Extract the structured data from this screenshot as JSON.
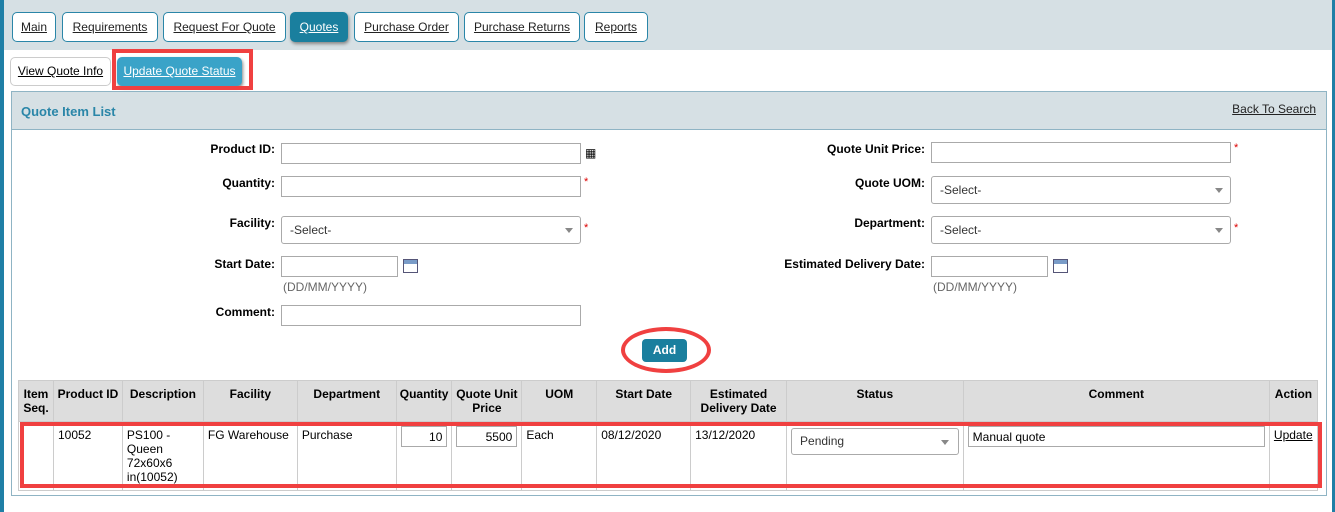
{
  "nav": {
    "tabs": [
      "Main",
      "Requirements",
      "Request For Quote",
      "Quotes",
      "Purchase Order",
      "Purchase Returns",
      "Reports"
    ],
    "active": "Quotes"
  },
  "subtabs": {
    "items": [
      "View Quote Info",
      "Update Quote Status"
    ],
    "active": "Update Quote Status"
  },
  "panel": {
    "title": "Quote Item List",
    "back_link": "Back To Search"
  },
  "form": {
    "product_id_label": "Product ID:",
    "quantity_label": "Quantity:",
    "facility_label": "Facility:",
    "facility_value": "-Select-",
    "start_date_label": "Start Date:",
    "date_hint": "(DD/MM/YYYY)",
    "comment_label": "Comment:",
    "unit_price_label": "Quote Unit Price:",
    "uom_label": "Quote UOM:",
    "uom_value": "-Select-",
    "department_label": "Department:",
    "department_value": "-Select-",
    "est_delivery_label": "Estimated Delivery Date:",
    "required_mark": "*",
    "add_label": "Add"
  },
  "table": {
    "headers": [
      "Item Seq.",
      "Product ID",
      "Description",
      "Facility",
      "Department",
      "Quantity",
      "Quote Unit Price",
      "UOM",
      "Start Date",
      "Estimated Delivery Date",
      "Status",
      "Comment",
      "Action"
    ],
    "rows": [
      {
        "seq": "",
        "product_id": "10052",
        "description": "PS100 - Queen 72x60x6 in(10052)",
        "facility": "FG Warehouse",
        "department": "Purchase",
        "quantity": "10",
        "unit_price": "5500",
        "uom": "Each",
        "start_date": "08/12/2020",
        "est_delivery": "13/12/2020",
        "status": "Pending",
        "comment": "Manual quote",
        "action": "Update"
      }
    ]
  },
  "colors": {
    "accent": "#1a7f9e",
    "highlight": "#f04040",
    "header_band": "#d6e0e4"
  }
}
